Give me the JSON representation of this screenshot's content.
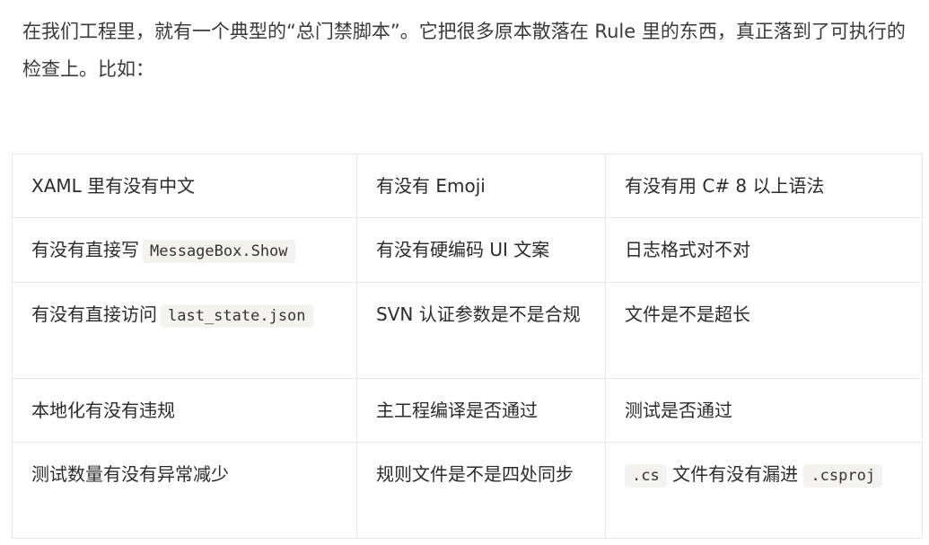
{
  "intro": {
    "text": "在我们工程里，就有一个典型的“总门禁脚本”。它把很多原本散落在 Rule 里的东西，真正落到了可执行的检查上。比如："
  },
  "table": {
    "rows": [
      {
        "c1": {
          "pre": "XAML 里有没有中文",
          "code": "",
          "post": ""
        },
        "c2": {
          "pre": "有没有 Emoji",
          "code": "",
          "post": ""
        },
        "c3": {
          "pre": "有没有用 C# 8 以上语法",
          "code": "",
          "post": ""
        }
      },
      {
        "c1": {
          "pre": "有没有直接写",
          "code": "MessageBox.Show",
          "post": ""
        },
        "c2": {
          "pre": "有没有硬编码 UI 文案",
          "code": "",
          "post": ""
        },
        "c3": {
          "pre": "日志格式对不对",
          "code": "",
          "post": ""
        }
      },
      {
        "c1": {
          "pre": "有没有直接访问",
          "code": "last_state.json",
          "post": ""
        },
        "c2": {
          "pre": "SVN 认证参数是不是合规",
          "code": "",
          "post": ""
        },
        "c3": {
          "pre": "文件是不是超长",
          "code": "",
          "post": ""
        }
      },
      {
        "c1": {
          "pre": "本地化有没有违规",
          "code": "",
          "post": ""
        },
        "c2": {
          "pre": "主工程编译是否通过",
          "code": "",
          "post": ""
        },
        "c3": {
          "pre": "测试是否通过",
          "code": "",
          "post": ""
        }
      },
      {
        "c1": {
          "pre": "测试数量有没有异常减少",
          "code": "",
          "post": ""
        },
        "c2": {
          "pre": "规则文件是不是四处同步",
          "code": "",
          "post": ""
        },
        "c3": {
          "pre": "",
          "code": ".cs",
          "post": "文件有没有漏进",
          "code2": ".csproj"
        }
      }
    ]
  }
}
